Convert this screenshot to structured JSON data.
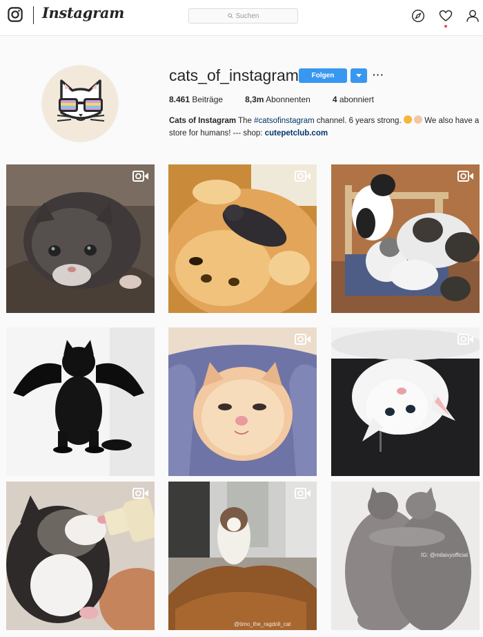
{
  "nav": {
    "logo_text": "Instagram",
    "search_placeholder": "Suchen",
    "icons": [
      "compass-icon",
      "heart-icon",
      "person-icon"
    ]
  },
  "profile": {
    "username": "cats_of_instagram",
    "follow_label": "Folgen",
    "more_label": "···",
    "stats": {
      "posts_count": "8.461",
      "posts_label": "Beiträge",
      "followers_count": "8,3m",
      "followers_label": "Abonnenten",
      "following_count": "4",
      "following_label": "abonniert"
    },
    "bio": {
      "name": "Cats of Instagram",
      "text_1": " The ",
      "hashtag": "#catsofinstagram",
      "text_2": " channel. 6 years strong. ",
      "text_3": " We also have a store for humans! --- shop: ",
      "link": "cutepetclub.com"
    }
  },
  "posts": [
    {
      "subject": "grey fluffy kitten on blanket",
      "video": true
    },
    {
      "subject": "black kitten sleeping on golden retriever",
      "video": true
    },
    {
      "subject": "kittens playing on wooden chair",
      "video": true
    },
    {
      "subject": "black kitten with bat wings",
      "video": false,
      "watermark": ""
    },
    {
      "subject": "ginger kitten wrapped in blue towel",
      "video": true
    },
    {
      "subject": "white kitten upside down on black sweater",
      "video": true
    },
    {
      "subject": "kitten drinking from bottle",
      "video": true
    },
    {
      "subject": "ragdoll cat in pile of leaves",
      "video": true,
      "watermark": "@timo_the_ragdoll_cat"
    },
    {
      "subject": "two grey cats hugging",
      "video": false,
      "watermark": "IG: @milaivyofficial"
    }
  ],
  "colors": {
    "accent": "#3897f0",
    "link": "#003569",
    "notification_dot": "#ed4956"
  }
}
